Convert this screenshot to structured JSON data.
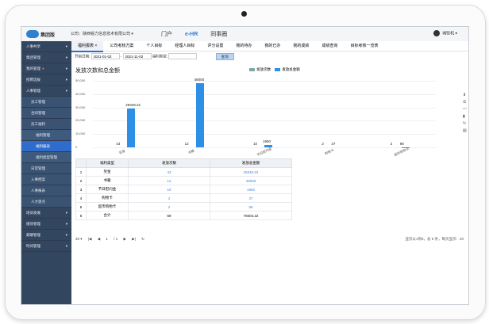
{
  "brand": "集团版",
  "company": "公司：陕西锐力信息技术有限公司 ▾",
  "topnav": [
    "门户",
    "e-HR",
    "同事圈"
  ],
  "user": "城驳机 ▾",
  "sidebar": [
    {
      "label": "人事共享",
      "level": 1
    },
    {
      "label": "集团管理",
      "level": 1
    },
    {
      "label": "我的管理",
      "level": 1,
      "badge": "●"
    },
    {
      "label": "招聘选拔",
      "level": 1
    },
    {
      "label": "人事管理",
      "level": 1
    },
    {
      "label": "员工管理",
      "level": 2
    },
    {
      "label": "合同管理",
      "level": 2
    },
    {
      "label": "员工福利",
      "level": 2
    },
    {
      "label": "福利管理",
      "level": 3
    },
    {
      "label": "福利报表",
      "level": 3,
      "active": true
    },
    {
      "label": "福利类型管理",
      "level": 3
    },
    {
      "label": "日常管理",
      "level": 2
    },
    {
      "label": "入事档案",
      "level": 2
    },
    {
      "label": "人事报表",
      "level": 2
    },
    {
      "label": "人才盘点",
      "level": 2
    },
    {
      "label": "培训发展",
      "level": 1
    },
    {
      "label": "绩效管理",
      "level": 1
    },
    {
      "label": "薪酬管理",
      "level": 1
    },
    {
      "label": "时间管理",
      "level": 1
    }
  ],
  "tabs": [
    "福利报表 ×",
    "公司考核方案",
    "个人目标",
    "经理人目标",
    "评分设置",
    "我的待办",
    "我的已办",
    "我的成绩",
    "成绩查询",
    "目标考核一览表"
  ],
  "filter": {
    "start_label": "开始日期:",
    "start": "2021-01-02",
    "end": "2021-11-02",
    "type_label": "福利类型:",
    "query": "查询"
  },
  "chart_data": {
    "type": "bar",
    "title": "发放次数和总金额",
    "categories": [
      "奖金",
      "书籍",
      "节日慰问金",
      "购物卡",
      "超市购物卡"
    ],
    "series": [
      {
        "name": "发放次数",
        "values": [
          43,
          12,
          10,
          2,
          2
        ]
      },
      {
        "name": "发放总金额",
        "values": [
          29349.22,
          48000,
          1950,
          37,
          98
        ]
      }
    ],
    "ylim": [
      0,
      50000
    ],
    "yticks": [
      "50,000",
      "40,000",
      "30,000",
      "20,000",
      "10,000",
      "0"
    ]
  },
  "table": {
    "headers": [
      "福利类型",
      "发放次数",
      "发放总金额"
    ],
    "rows": [
      [
        "1",
        "奖金",
        "43",
        "29349.22"
      ],
      [
        "2",
        "书籍",
        "12",
        "48000"
      ],
      [
        "3",
        "节日慰问金",
        "10",
        "1950"
      ],
      [
        "4",
        "购物卡",
        "2",
        "37"
      ],
      [
        "5",
        "超市购物卡",
        "2",
        "98"
      ],
      [
        "6",
        "合计",
        "69",
        "79404.22"
      ]
    ]
  },
  "pager": {
    "size": "20 ▾",
    "page": "1",
    "total": "/ 1",
    "info": "显示从1到6，总 6 条，每页显示：20"
  },
  "colors": {
    "count": "#7fa7a6",
    "amount": "#2e8fe6"
  }
}
